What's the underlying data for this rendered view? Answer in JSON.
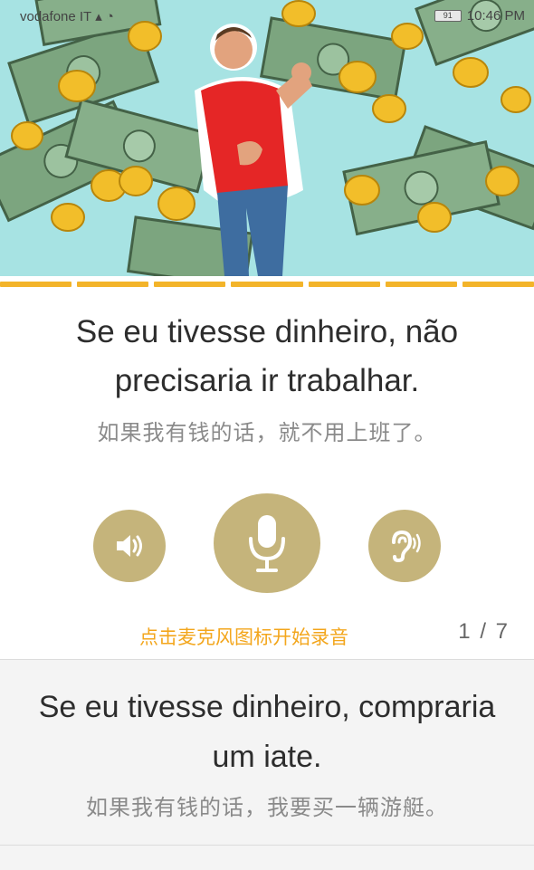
{
  "status_bar": {
    "carrier": "vodafone IT",
    "time": "10:46 PM",
    "battery": "91"
  },
  "hero": {
    "image_description_icon": "man-celebrating-money-illustration"
  },
  "progress": {
    "segments": 7
  },
  "current_sentence": {
    "portuguese": "Se eu tivesse dinheiro, não precisaria ir trabalhar.",
    "chinese": "如果我有钱的话，就不用上班了。"
  },
  "controls": {
    "speaker_icon": "speaker-icon",
    "mic_icon": "microphone-icon",
    "ear_icon": "ear-icon"
  },
  "hint": "点击麦克风图标开始录音",
  "counter": "1 / 7",
  "next_sentence": {
    "portuguese": "Se eu tivesse dinheiro, compraria um iate.",
    "chinese": "如果我有钱的话，我要买一辆游艇。"
  },
  "colors": {
    "accent_gold": "#c5b47b",
    "progress_orange": "#f3b42a",
    "hint_orange": "#f3a61c"
  }
}
